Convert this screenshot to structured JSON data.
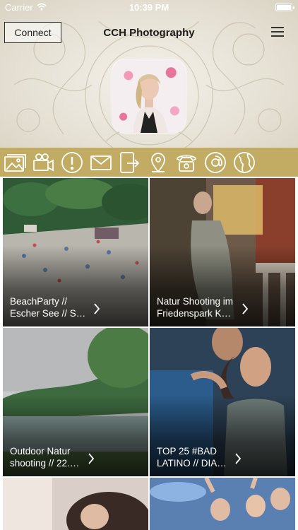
{
  "status_bar": {
    "carrier": "Carrier",
    "time": "10:39 PM"
  },
  "header": {
    "connect_label": "Connect",
    "title": "CCH Photography"
  },
  "theme": {
    "accent": "#c2ab63",
    "background": "#e7e2d6"
  },
  "icon_bar": {
    "icons": [
      "gallery-icon",
      "video-camera-icon",
      "info-icon",
      "mail-icon",
      "tablet-share-icon",
      "map-pin-icon",
      "telephone-icon",
      "at-sign-icon",
      "globe-icon"
    ]
  },
  "gallery": [
    {
      "caption": "BeachParty // Escher See // S…"
    },
    {
      "caption": "Natur Shooting im Friedenspark K…"
    },
    {
      "caption": "Outdoor Natur shooting // 22.…"
    },
    {
      "caption": "TOP 25 #BAD LATINO // DIA…"
    },
    {
      "caption": ""
    },
    {
      "caption": ""
    }
  ]
}
